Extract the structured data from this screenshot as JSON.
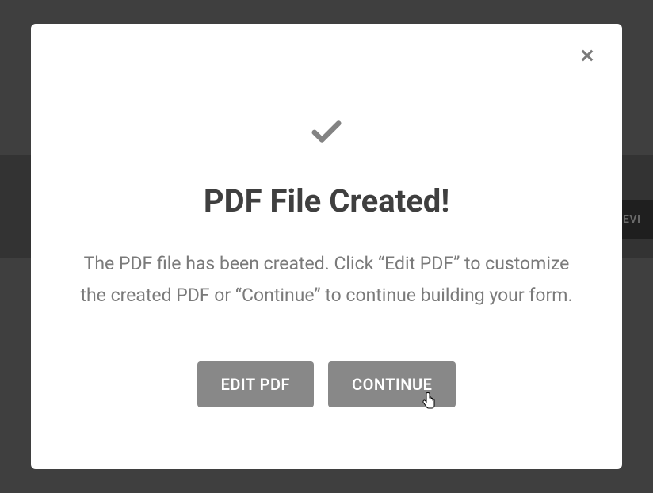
{
  "modal": {
    "title": "PDF File Created!",
    "description": "The PDF file has been created. Click “Edit PDF” to customize the created PDF or “Continue” to continue building your form.",
    "buttons": {
      "edit_pdf": "EDIT PDF",
      "continue": "CONTINUE"
    }
  },
  "background": {
    "preview_fragment": "EVI"
  }
}
